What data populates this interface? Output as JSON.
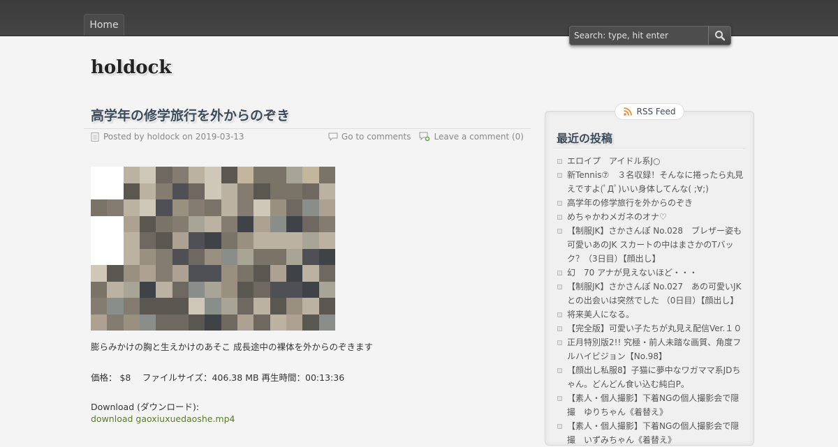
{
  "nav": {
    "home_label": "Home"
  },
  "search": {
    "placeholder": "Search: type, hit enter"
  },
  "site": {
    "title": "holdock"
  },
  "post": {
    "title": "高学年の修学旅行を外からのぞき",
    "meta": {
      "posted_by": "Posted by holdock on 2019-03-13",
      "go_to_comments": "Go to comments",
      "leave_comment": "Leave a comment (0)"
    },
    "description": "膨らみかけの胸と生えかけのあそこ 成長途中の裸体を外からのぞきます",
    "details": "価格： $8　 ファイルサイズ：406.38 MB 再生時間：00:13:36",
    "download_label": "Download (ダウンロード):",
    "download_link": "download gaoxiuxuedaoshe.mp4"
  },
  "sidebar": {
    "rss_label": "RSS Feed",
    "recent_title": "最近の投稿",
    "recent_posts": [
      "エロイプ　アイドル系J○",
      "新Tennis⑦　３名収録！そんなに捲ったら丸見えですよ(ﾟДﾟ)いい身体してんな( ;∀;)",
      "高学年の修学旅行を外からのぞき",
      "めちゃかわメガネのオナ♡",
      "【制服JK】さかさんぽ No.028　ブレザー姿も可愛いあのJK スカートの中はまさかのTバック？（3日目）【顔出し】",
      "幻　70 アナが見えないほど・・・",
      "【制服JK】さかさんぽ No.027　あの可愛いJKとの出会いは突然でした （0日目）【顔出し】",
      "将来美人になる。",
      "【完全版】可愛い子たちが丸見え配信Ver.１０",
      "正月特別版2!! 究極・前人未踏な画質、角度フルハイビジョン【No.98】",
      "【顔出し私服8】子猫に夢中なワガママ系JDちゃん。どんどん食い込む純白P。",
      "【素人・個人撮影】下着NGの個人撮影会で隠撮　ゆりちゃん《着替え》",
      "【素人・個人撮影】下着NGの個人撮影会で隠撮　いずみちゃん《着替え》"
    ]
  },
  "colors": {
    "topbar": "#444444",
    "accent_link": "#5b7a2e",
    "heading": "#3a4a5a",
    "rss_orange": "#f08a24"
  },
  "icons": {
    "search": "magnifier-icon",
    "posted": "document-icon",
    "comments": "speech-bubble-icon",
    "leave_comment": "add-comment-icon",
    "rss": "rss-icon"
  }
}
